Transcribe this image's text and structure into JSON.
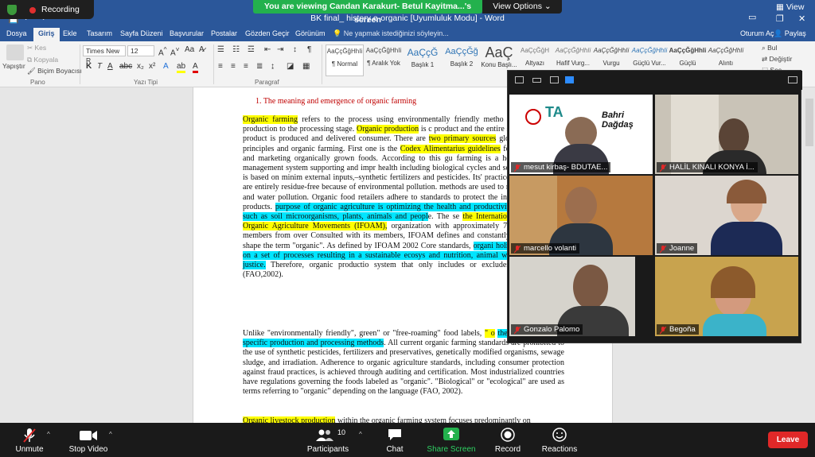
{
  "zoom_top": {
    "recording_label": "Recording",
    "viewing_banner": "You are viewing Candan Karakurt- Betul Kayitma...'s screen",
    "view_options": "View Options",
    "view_label": "View"
  },
  "word": {
    "window_title": "BK final_ history e-organic [Uyumluluk Modu] - Word",
    "tabs": [
      "Dosya",
      "Giriş",
      "Ekle",
      "Tasarım",
      "Sayfa Düzeni",
      "Başvurular",
      "Postalar",
      "Gözden Geçir",
      "Görünüm"
    ],
    "tell_me": "Ne yapmak istediğinizi söyleyin...",
    "user": "Oturum Aç",
    "share": "Paylaş",
    "clipboard": {
      "paste": "Yapıştır",
      "cut": "Kes",
      "copy": "Kopyala",
      "format_painter": "Biçim Boyacısı",
      "group": "Pano"
    },
    "font": {
      "name": "Times New R",
      "size": "12",
      "group": "Yazı Tipi"
    },
    "paragraph_group": "Paragraf",
    "styles": [
      {
        "preview": "AaÇçĞğHhIi",
        "name": "¶ Normal"
      },
      {
        "preview": "AaÇçĞğHhIi",
        "name": "¶ Aralık Yok"
      },
      {
        "preview": "AaÇçĞ",
        "name": "Başlık 1"
      },
      {
        "preview": "AaÇçĞğ",
        "name": "Başlık 2"
      },
      {
        "preview": "AaÇ",
        "name": "Konu Başlı..."
      },
      {
        "preview": "AaÇçĞğH",
        "name": "Altyazı"
      },
      {
        "preview": "AaÇçĞğHhIi",
        "name": "Hafif Vurg..."
      },
      {
        "preview": "AaÇçĞğHhIi",
        "name": "Vurgu"
      },
      {
        "preview": "AaÇçĞğHhIi",
        "name": "Güçlü Vur..."
      },
      {
        "preview": "AaÇçĞğHhIi",
        "name": "Güçlü"
      },
      {
        "preview": "AaÇçĞğHhIi",
        "name": "Alıntı"
      }
    ],
    "editing": {
      "find": "Bul",
      "replace": "Değiştir",
      "select": "Seç"
    }
  },
  "document": {
    "heading": "1.   The meaning and emergence of organic farming",
    "p1": [
      {
        "t": "Organic farming",
        "h": "y"
      },
      {
        "t": " refers to the process using environmentally friendly metho the beginning of production to the processing stage. "
      },
      {
        "t": "Organic production",
        "h": "y"
      },
      {
        "t": " is c product and the entire system, which the product is produced and delivered consumer. There are "
      },
      {
        "t": "two primary sources",
        "h": "y"
      },
      {
        "t": " globally for general principles and organic farming. First one is the "
      },
      {
        "t": "Codex Alimentarius guidelines",
        "h": "y"
      },
      {
        "t": " for produ labeling, and marketing organically grown foods. According to this gu farming is a holistic production management system supporting and impr health including biological cycles and soil microbiome. It is based on minim external inputs,–synthetic fertilizers and pesticides. Its' practices canno products are entirely residue-free because of environmental pollution. methods are used to minimize air, soil, and water pollution. Organic food retailers adhere to standards to protect the integrity of organic products. "
      },
      {
        "t": "purpose of organic agriculture is optimizing the health and productivity o communities such as soil microorganisms, plants, animals and peopl",
        "h": "c"
      },
      {
        "t": "e. The se "
      },
      {
        "t": "the International Federation of Organic Agriculture Movements (IFOAM),",
        "h": "y"
      },
      {
        "t": " organization with approximately 750 private sector members from over Consulted with its members, IFOAM defines and constantly reviews the bas shape the term \"organic\". As defined by IFOAM 2002 Core standards, "
      },
      {
        "t": "organi holistic system based on a set of processes resulting in a sustainable ecosys and nutrition, animal welfare, and social justice.",
        "h": "c"
      },
      {
        "t": " Therefore, organic productio system that only includes or excludes specific inputs (FAO,2002)."
      }
    ],
    "p2": [
      {
        "t": "Unlike \"environmentally friendly\", green\" or \"free-roaming\" food labels, "
      },
      {
        "t": "\" o",
        "h": "y"
      },
      {
        "t": " "
      },
      {
        "t": "the compliance with specific production and processing methods",
        "h": "c"
      },
      {
        "t": ". All current organic farming standards are prohibited to the use of synthetic pesticides, fertilizers and preservatives, genetically modified organisms, sewage sludge, and irradiation. Adherence to organic agriculture standards, including consumer protection against fraud practices, is achieved through auditing and certification. Most industrialized countries have regulations governing the foods labeled as \"organic\". \"Biological\" or \"ecological\" are used as terms referring to \"organic\" depending on the language (FAO, 2002)."
      }
    ],
    "p3": [
      {
        "t": "Organic livestock production",
        "h": "y"
      },
      {
        "t": " within the organic farming system focuses predominantly on"
      }
    ]
  },
  "participants": [
    {
      "name": "mesut kirbaş- BDUTAE...",
      "logo_text": "Bahri Dağdaş",
      "bg": "#ffffff"
    },
    {
      "name": "HALİL KINALI KONYA İ...",
      "bg": "#c9c3b7"
    },
    {
      "name": "marcello volanti",
      "bg": "#b6793e"
    },
    {
      "name": "Joanne",
      "bg": "#dcd6cf"
    },
    {
      "name": "Gonzalo Palomo",
      "bg": "#d6d3cc"
    },
    {
      "name": "Begoña",
      "bg": "#c8a34e"
    }
  ],
  "zoom_toolbar": {
    "unmute": "Unmute",
    "stop_video": "Stop Video",
    "participants": "Participants",
    "participants_count": "10",
    "chat": "Chat",
    "share_screen": "Share Screen",
    "record": "Record",
    "reactions": "Reactions",
    "leave": "Leave"
  },
  "colors": {
    "word_blue": "#2b579a",
    "zoom_green": "#23b14d",
    "leave_red": "#e02828",
    "highlight_yellow": "#ffff00",
    "highlight_cyan": "#00e5ff"
  }
}
